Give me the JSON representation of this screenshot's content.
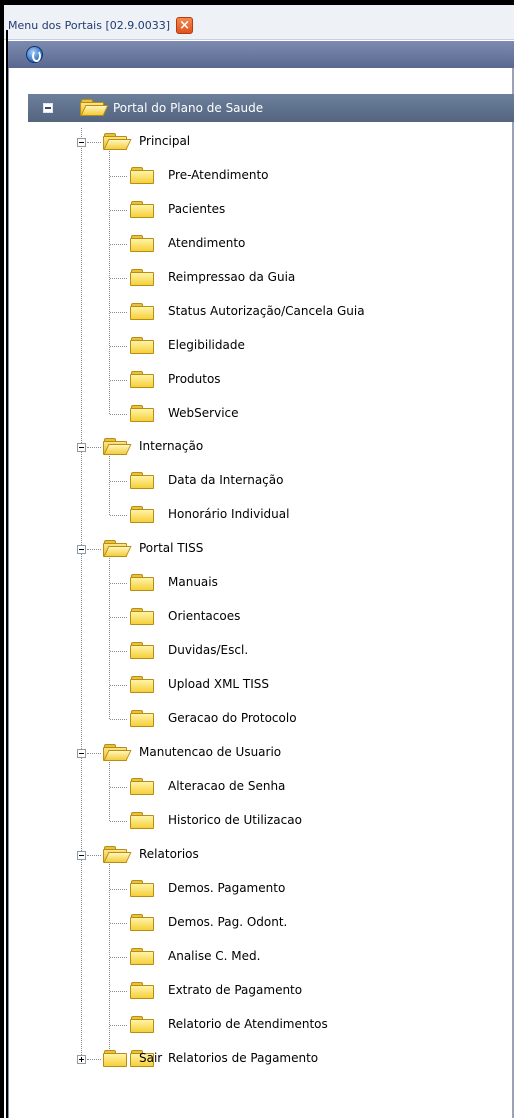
{
  "tab": {
    "title": "Menu dos Portais [02.9.0033]",
    "close_glyph": "×"
  },
  "colors": {
    "header": "#5a6790",
    "root_bar": "#53657f",
    "folder": "#f6cf3a",
    "close": "#e0531b"
  },
  "tree": {
    "root_label": "Portal do Plano de Saude",
    "groups": [
      {
        "label": "Principal",
        "items": [
          "Pre-Atendimento",
          "Pacientes",
          "Atendimento",
          "Reimpressao da Guia",
          "Status Autorização/Cancela Guia",
          "Elegibilidade",
          "Produtos",
          "WebService"
        ]
      },
      {
        "label": "Internação",
        "items": [
          "Data da Internação",
          "Honorário Individual"
        ]
      },
      {
        "label": "Portal TISS",
        "items": [
          "Manuais",
          "Orientacoes",
          "Duvidas/Escl.",
          "Upload XML TISS",
          "Geracao do Protocolo"
        ]
      },
      {
        "label": "Manutencao de Usuario",
        "items": [
          "Alteracao de Senha",
          "Historico de Utilizacao"
        ]
      },
      {
        "label": "Relatorios",
        "items": [
          "Demos. Pagamento",
          "Demos. Pag. Odont.",
          "Analise C. Med.",
          "Extrato de Pagamento",
          "Relatorio de Atendimentos",
          "Relatorios de Pagamento"
        ]
      },
      {
        "label": "Sair",
        "items": []
      }
    ]
  }
}
